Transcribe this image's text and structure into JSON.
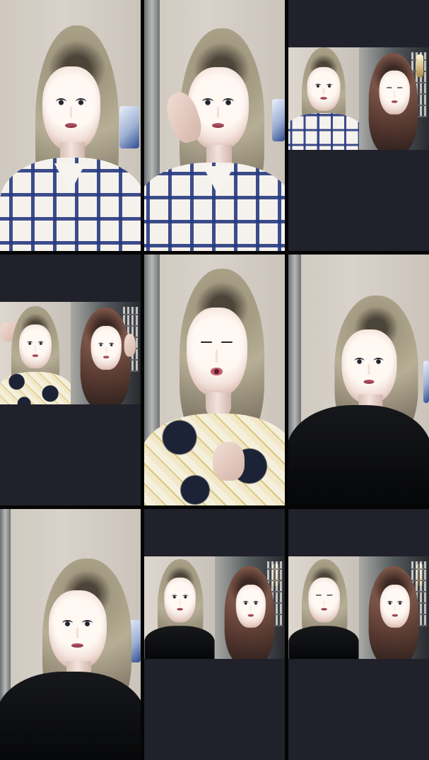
{
  "grid": {
    "layout": "3x3 video grid",
    "background": "#050505",
    "tile_background": "#20212b"
  },
  "tiles": [
    {
      "name": "tile-1",
      "kind": "single-video"
    },
    {
      "name": "tile-2",
      "kind": "single-video"
    },
    {
      "name": "tile-3",
      "kind": "split-video-window"
    },
    {
      "name": "tile-4",
      "kind": "split-video-window"
    },
    {
      "name": "tile-5",
      "kind": "single-video"
    },
    {
      "name": "tile-6",
      "kind": "single-video"
    },
    {
      "name": "tile-7",
      "kind": "single-video"
    },
    {
      "name": "tile-8",
      "kind": "split-video-window"
    },
    {
      "name": "tile-9",
      "kind": "split-video-window"
    }
  ]
}
